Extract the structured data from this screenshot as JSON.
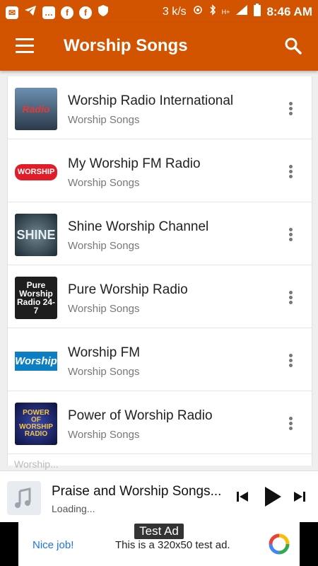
{
  "status_bar": {
    "speed": "3 k/s",
    "network": "H+",
    "time": "8:46 AM",
    "icons": [
      "message-icon",
      "telegram-icon",
      "sms-icon",
      "facebook-icon",
      "facebook-icon",
      "vpn-shield-icon",
      "hotspot-icon",
      "bluetooth-icon",
      "signal-icon",
      "battery-icon"
    ]
  },
  "app_bar": {
    "title": "Worship Songs",
    "menu_icon": "hamburger-menu-icon",
    "search_icon": "search-icon"
  },
  "stations": [
    {
      "name": "Worship Radio International",
      "category": "Worship Songs",
      "thumb_text": "Radio",
      "thumb_colors": [
        "#4a6a8a",
        "#d22"
      ]
    },
    {
      "name": "My Worship FM Radio",
      "category": "Worship Songs",
      "thumb_text": "WORSHIP",
      "thumb_colors": [
        "#fff",
        "#e21"
      ]
    },
    {
      "name": "Shine Worship Channel",
      "category": "Worship Songs",
      "thumb_text": "SHINE",
      "thumb_colors": [
        "#2c3e4a",
        "#cfd8dc"
      ]
    },
    {
      "name": "Pure Worship Radio",
      "category": "Worship Songs",
      "thumb_text": "Pure Worship Radio 24-7",
      "thumb_colors": [
        "#1e1e1e",
        "#fff"
      ]
    },
    {
      "name": "Worship FM",
      "category": "Worship Songs",
      "thumb_text": "Worship",
      "thumb_colors": [
        "#0b7ec4",
        "#fff"
      ]
    },
    {
      "name": "Power of Worship Radio",
      "category": "Worship Songs",
      "thumb_text": "POWER OF WORSHIP RADIO",
      "thumb_colors": [
        "#1a1e6e",
        "#f4c542"
      ]
    }
  ],
  "partial_row_text": "Worship...",
  "player": {
    "title": "Praise and Worship Songs...",
    "status": "Loading...",
    "icons": [
      "music-note-icon",
      "skip-previous-icon",
      "play-icon",
      "skip-next-icon"
    ]
  },
  "ad": {
    "badge": "Test Ad",
    "link": "Nice job!",
    "text": "This is a 320x50 test ad.",
    "logo": "admob-logo-icon"
  },
  "colors": {
    "accent": "#d35400",
    "subtitle": "#777777"
  }
}
